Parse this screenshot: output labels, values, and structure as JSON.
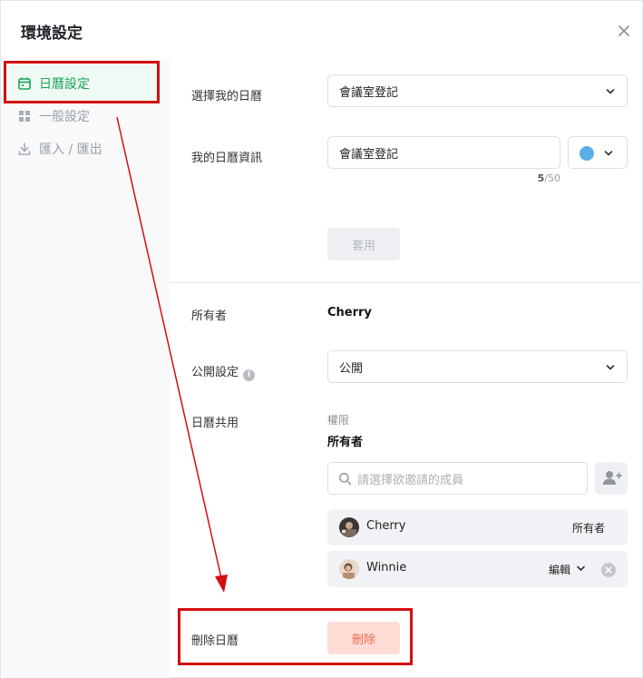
{
  "dialog": {
    "title": "環境設定"
  },
  "sidebar": {
    "items": [
      {
        "label": "日曆設定",
        "icon": "calendar-icon",
        "active": true
      },
      {
        "label": "一般設定",
        "icon": "grid-icon",
        "active": false
      },
      {
        "label": "匯入 / 匯出",
        "icon": "download-icon",
        "active": false
      }
    ]
  },
  "form": {
    "select_calendar_label": "選擇我的日曆",
    "select_calendar_value": "會議室登記",
    "calendar_info_label": "我的日曆資訊",
    "calendar_info_value": "會議室登記",
    "counter_current": "5",
    "counter_max": "/50",
    "color": "#5aaee8",
    "apply_label": "套用",
    "owner_label": "所有者",
    "owner_value": "Cherry",
    "public_label": "公開設定",
    "info_glyph": "i",
    "public_value": "公開",
    "share_label": "日曆共用",
    "perm_label": "權限",
    "perm_value": "所有者",
    "search_placeholder": "請選擇欲邀請的成員",
    "members": [
      {
        "name": "Cherry",
        "role": "所有者"
      },
      {
        "name": "Winnie",
        "role": "編輯"
      }
    ],
    "delete_label": "刪除日曆",
    "delete_button": "刪除"
  },
  "colors": {
    "accent": "#1ba35a",
    "highlight": "#d40f0f",
    "danger": "#f06a50"
  }
}
